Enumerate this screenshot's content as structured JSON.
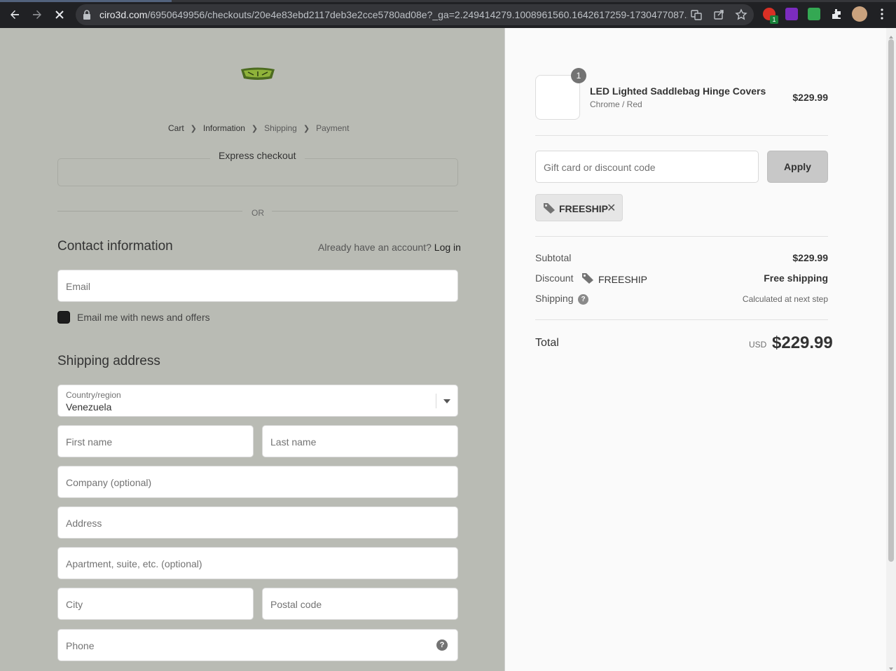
{
  "browser": {
    "url_host": "ciro3d.com",
    "url_path": "/6950649956/checkouts/20e4e83ebd2117deb3e2cce5780ad08e?_ga=2.249414279.1008961560.1642617259-1730477087....",
    "extension_badge": "1"
  },
  "breadcrumb": {
    "cart": "Cart",
    "information": "Information",
    "shipping": "Shipping",
    "payment": "Payment"
  },
  "express": {
    "title": "Express checkout",
    "or": "OR"
  },
  "contact": {
    "title": "Contact information",
    "account_prompt": "Already have an account?",
    "login": "Log in",
    "email_placeholder": "Email",
    "newsletter_label": "Email me with news and offers"
  },
  "shipping": {
    "title": "Shipping address",
    "country_label": "Country/region",
    "country_value": "Venezuela",
    "first_name": "First name",
    "last_name": "Last name",
    "company": "Company (optional)",
    "address": "Address",
    "apartment": "Apartment, suite, etc. (optional)",
    "city": "City",
    "postal": "Postal code",
    "phone": "Phone",
    "help": "?"
  },
  "summary": {
    "product": {
      "quantity": "1",
      "name": "LED Lighted Saddlebag Hinge Covers",
      "variant": "Chrome / Red",
      "price": "$229.99"
    },
    "gift_placeholder": "Gift card or discount code",
    "apply": "Apply",
    "discount_tag": "FREESHIP",
    "subtotal_label": "Subtotal",
    "subtotal_value": "$229.99",
    "discount_label": "Discount",
    "discount_code": "FREESHIP",
    "discount_value": "Free shipping",
    "shipping_label": "Shipping",
    "shipping_value": "Calculated at next step",
    "total_label": "Total",
    "total_currency": "USD",
    "total_value": "$229.99"
  },
  "colors": {
    "left_bg": "#b9bbb4",
    "right_bg": "#fafafa",
    "chrome_bg": "#202124"
  }
}
